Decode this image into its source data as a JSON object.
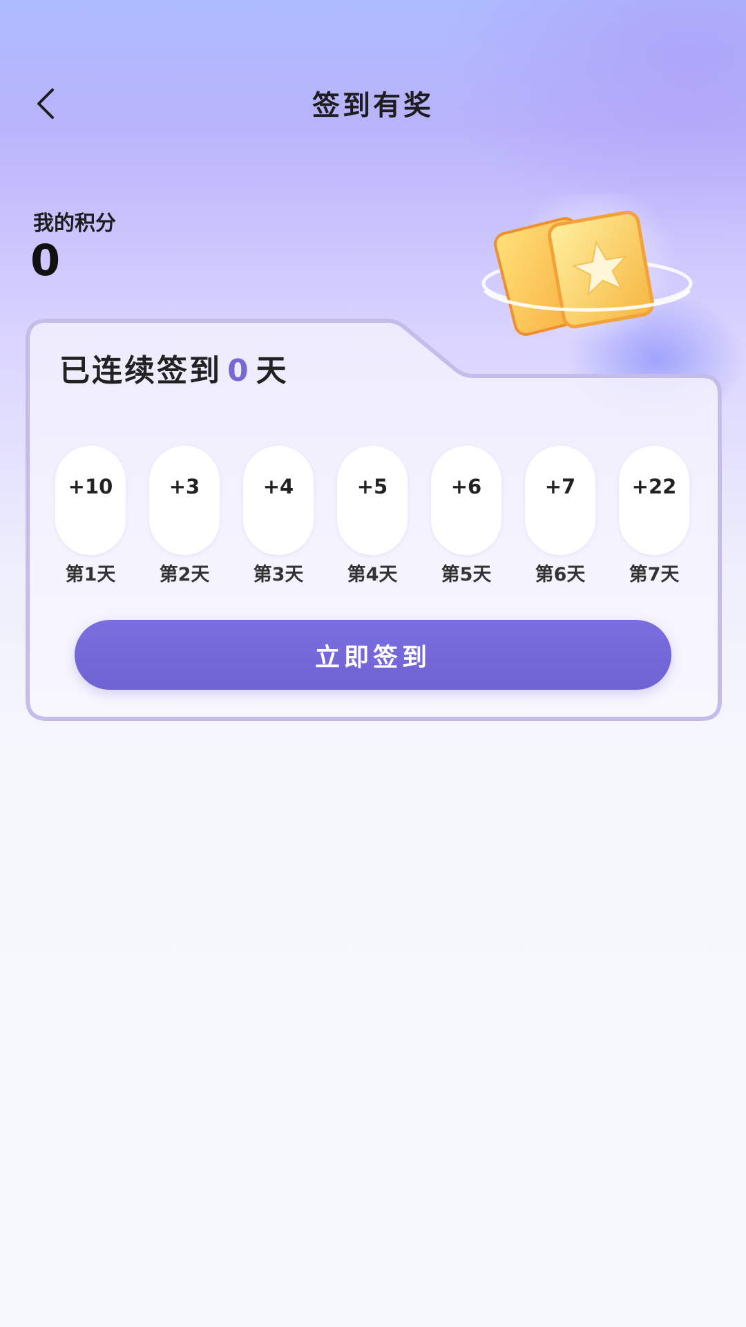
{
  "header": {
    "title": "签到有奖",
    "back_icon": "chevron-left-icon"
  },
  "points": {
    "label": "我的积分",
    "value": "0"
  },
  "streak": {
    "prefix": "已连续签到",
    "days": "0",
    "suffix": "天"
  },
  "rewards": [
    {
      "points": "+10",
      "label": "第1天"
    },
    {
      "points": "+3",
      "label": "第2天"
    },
    {
      "points": "+4",
      "label": "第3天"
    },
    {
      "points": "+5",
      "label": "第4天"
    },
    {
      "points": "+6",
      "label": "第5天"
    },
    {
      "points": "+7",
      "label": "第6天"
    },
    {
      "points": "+22",
      "label": "第7天"
    }
  ],
  "cta": {
    "label": "立即签到"
  },
  "colors": {
    "accent": "#7669d4",
    "button": "#7265d8",
    "card_border": "#c4bde9"
  }
}
